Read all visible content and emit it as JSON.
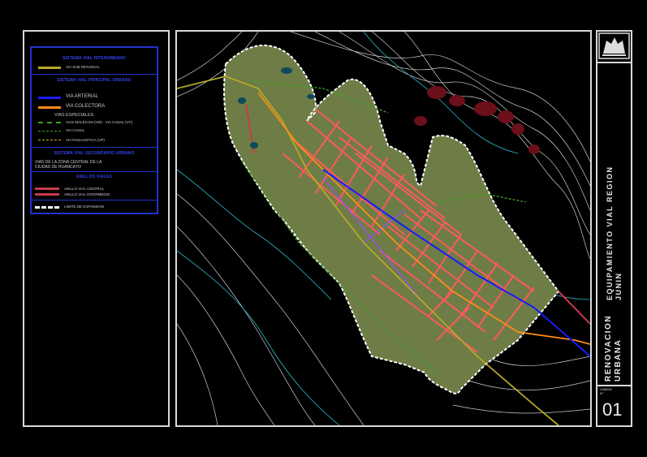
{
  "legend": {
    "sections": {
      "interurbano": "SISTEMA VIAL INTERURBANO",
      "principal": "SISTEMA VIAL PRINCIPAL URBANO",
      "secundario": "SISTEMA VIAL SECUNDARIO URBANO",
      "anillos": "ANILLOS VIALES"
    },
    "items": {
      "via_sub_regional": "VIA SUB REGIONAL",
      "via_arterial": "VIA ARTERIAL",
      "via_colectora": "VIA COLECTORA",
      "vias_especiales": "VIAS ESPECIALES",
      "vias_malecon": "VIAS MALECON (VM) - VIA CANAL (VC)",
      "via_canal": "VIA CANAL",
      "via_paisajistica": "VIA PAISAJISTICA (VP)",
      "vias_zona_central": "VIAS DE LA ZONA CENTRAL DE LA",
      "ciudad_huancayo": "CIUDAD DE HUANCAYO",
      "anillo_central": "ANILLO VIAL CENTRAL",
      "anillo_intermedio": "ANILLO VIAL INTERMEDIO",
      "limite_expansion": "LIMITE DE EXPANSION"
    },
    "colors": {
      "frame": "#2233cc",
      "sub_regional": "#b5a82a",
      "arterial": "#1a1aff",
      "colectora": "#ff8c1a",
      "malecon": "#3fa02a",
      "canal": "#3fa02a",
      "paisajistica": "#c8b820",
      "anillo": "#c83a4a",
      "limite": "#ffffff"
    }
  },
  "title_block": {
    "project_line1": "EQUIPAMIENTO VIAL REGION",
    "project_line2": "JUNIN",
    "plan_line1": "RENOVACION",
    "plan_line2": "URBANA",
    "sheet_label_1": "LAMINA",
    "sheet_label_2": "N°",
    "sheet_number": "01"
  },
  "map": {
    "colors": {
      "terrain": "#6e7d45",
      "contour": "#d0d0d0",
      "river": "#2ab8c8",
      "street": "#ff5a5a",
      "street_secondary": "#ff4d7a",
      "arterial": "#1a1aff",
      "colectora": "#ff8c1a",
      "sub_regional": "#b5a82a",
      "purple": "#9a4dff",
      "dark_red": "#6b0f1a",
      "limite": "#ffffff"
    }
  }
}
